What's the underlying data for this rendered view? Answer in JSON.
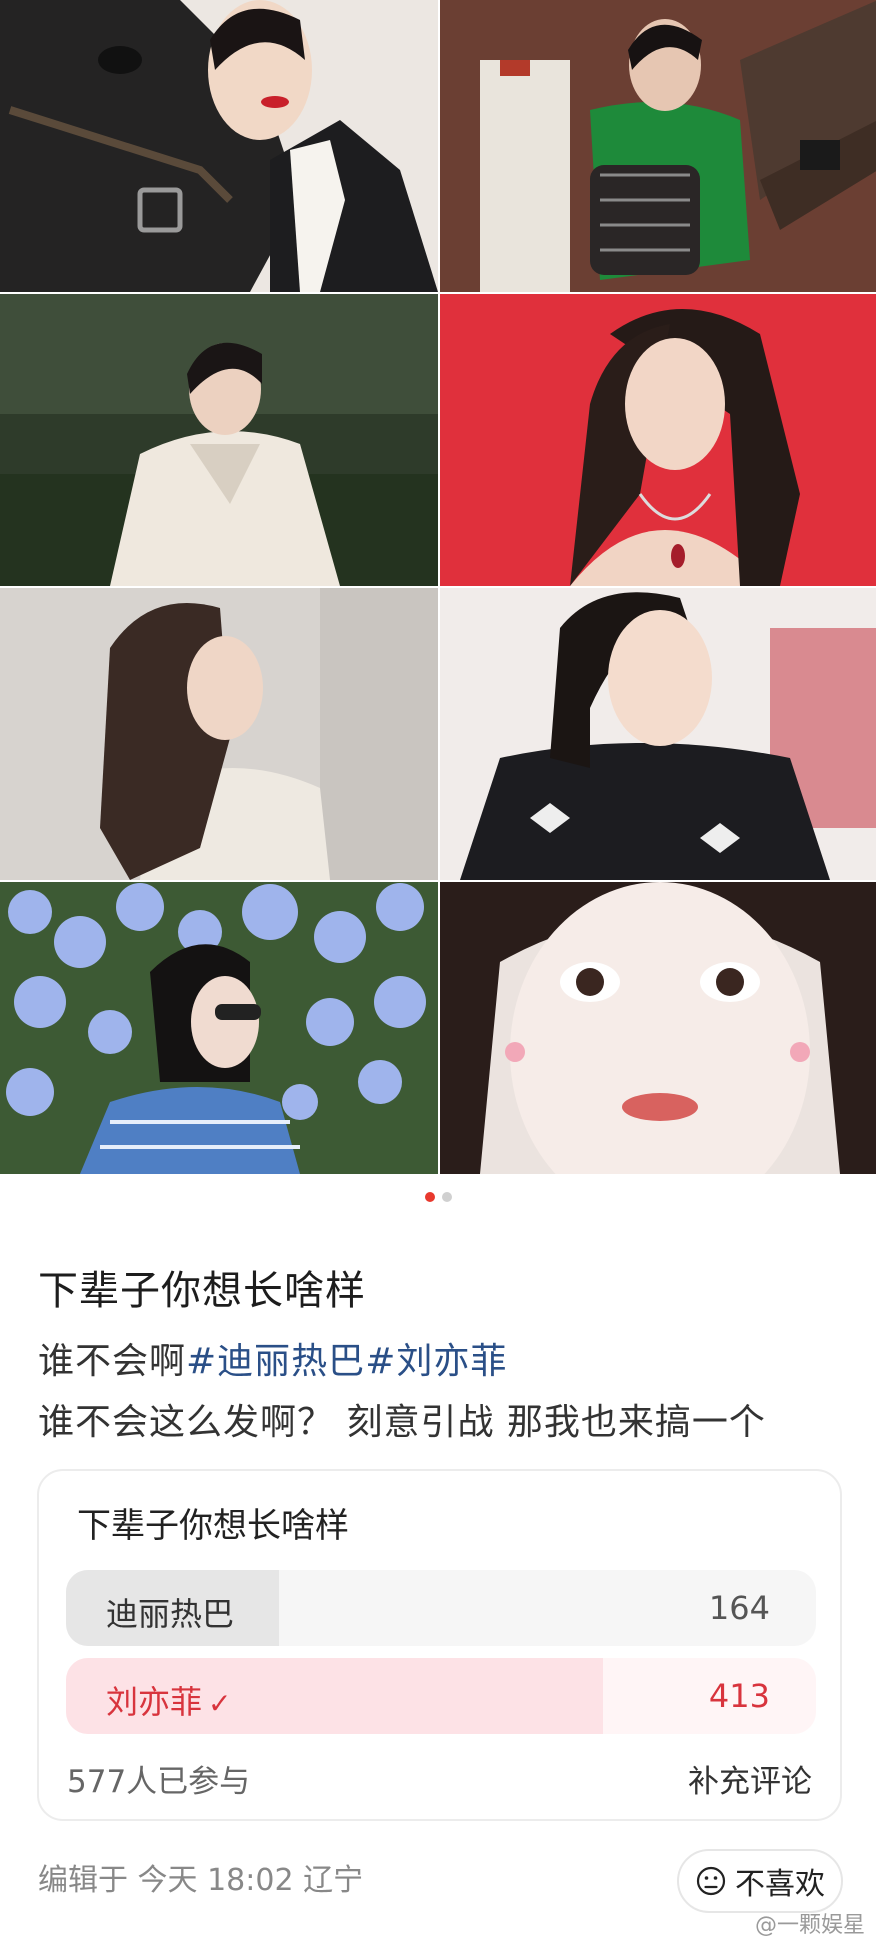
{
  "gallery": {
    "photos": [
      {
        "name": "photo-woman-with-horse"
      },
      {
        "name": "photo-woman-green-top-handbag"
      },
      {
        "name": "photo-woman-white-blouse-garden"
      },
      {
        "name": "photo-woman-red-backdrop"
      },
      {
        "name": "photo-woman-white-shirt-profile"
      },
      {
        "name": "photo-woman-black-top"
      },
      {
        "name": "photo-woman-sunglasses-flowers"
      },
      {
        "name": "photo-woman-closeup-makeup"
      }
    ],
    "pager": {
      "total": 2,
      "active": 1
    }
  },
  "post": {
    "title": "下辈子你想长啥样",
    "line1_prefix": "谁不会啊",
    "hashtag1": "#迪丽热巴",
    "hashtag2": "#刘亦菲",
    "line2": "谁不会这么发啊？ 刻意引战 那我也来搞一个"
  },
  "poll": {
    "title": "下辈子你想长啥样",
    "options": [
      {
        "label": "迪丽热巴",
        "count": "164",
        "fraction": 0.284,
        "selected": false
      },
      {
        "label": "刘亦菲",
        "count": "413",
        "fraction": 0.716,
        "selected": true
      }
    ],
    "participants": "577人已参与",
    "add_comment": "补充评论"
  },
  "footer": {
    "edit_info": "编辑于 今天 18:02 辽宁",
    "dislike_label": "不喜欢",
    "dislike_icon": "frown-face-icon",
    "watermark": "@一颗娱星"
  },
  "colors": {
    "accent_red": "#d8343d",
    "hashtag_blue": "#2a4f87",
    "pager_active": "#e8392e"
  }
}
